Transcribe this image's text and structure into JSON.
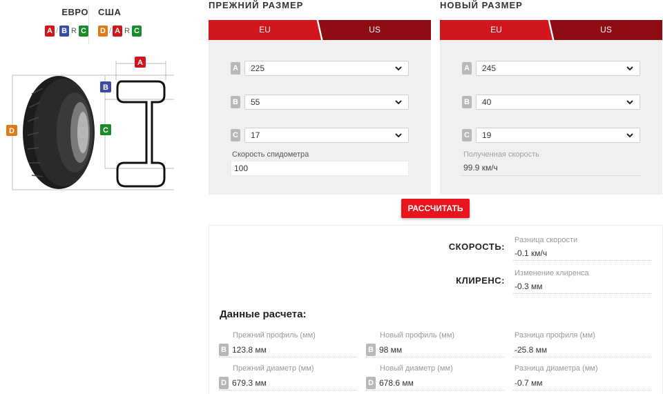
{
  "legend": {
    "euro_label": "ЕВРО",
    "usa_label": "США",
    "euro_chips": [
      "A",
      "B",
      "R",
      "C"
    ],
    "usa_chips": [
      "D",
      "A",
      "R",
      "C"
    ],
    "slash": "/"
  },
  "diagram": {
    "labels": {
      "a": "A",
      "b": "B",
      "c": "C",
      "d": "D"
    },
    "colors": {
      "a": "#d2161e",
      "b": "#3a4ca8",
      "c": "#1a8a2a",
      "d": "#e07a16"
    }
  },
  "old_size": {
    "title": "ПРЕЖНИЙ РАЗМЕР",
    "tabs": [
      {
        "label": "EU",
        "active": true
      },
      {
        "label": "US",
        "active": false
      }
    ],
    "rows": [
      {
        "badge": "A",
        "value": "225"
      },
      {
        "badge": "B",
        "value": "55"
      },
      {
        "badge": "C",
        "value": "17"
      }
    ],
    "speed_label": "Скорость спидометра",
    "speed_value": "100"
  },
  "new_size": {
    "title": "НОВЫЙ РАЗМЕР",
    "tabs": [
      {
        "label": "EU",
        "active": true
      },
      {
        "label": "US",
        "active": false
      }
    ],
    "rows": [
      {
        "badge": "A",
        "value": "245"
      },
      {
        "badge": "B",
        "value": "40"
      },
      {
        "badge": "C",
        "value": "19"
      }
    ],
    "speed_label": "Полученная скорость",
    "speed_value": "99.9 км/ч"
  },
  "calculate_label": "РАССЧИТАТЬ",
  "results": {
    "speed": {
      "label": "СКОРОСТЬ:",
      "caption": "Разница скорости",
      "value": "-0.1 км/ч"
    },
    "clearance": {
      "label": "КЛИРЕНС:",
      "caption": "Изменение клиренса",
      "value": "-0.3 мм"
    },
    "section_title": "Данные расчета:",
    "profile": [
      {
        "caption": "Прежний профиль (мм)",
        "badge": "B",
        "value": "123.8 мм"
      },
      {
        "caption": "Новый профиль (мм)",
        "badge": "B",
        "value": "98 мм"
      },
      {
        "caption": "Разница профиля (мм)",
        "badge": "",
        "value": "-25.8 мм"
      }
    ],
    "diameter": [
      {
        "caption": "Прежний диаметр (мм)",
        "badge": "D",
        "value": "679.3 мм"
      },
      {
        "caption": "Новый диаметр (мм)",
        "badge": "D",
        "value": "678.6 мм"
      },
      {
        "caption": "Разница диаметра (мм)",
        "badge": "",
        "value": "-0.7 мм"
      }
    ]
  },
  "icons": {
    "select_arrow": "chevron-down-icon"
  }
}
